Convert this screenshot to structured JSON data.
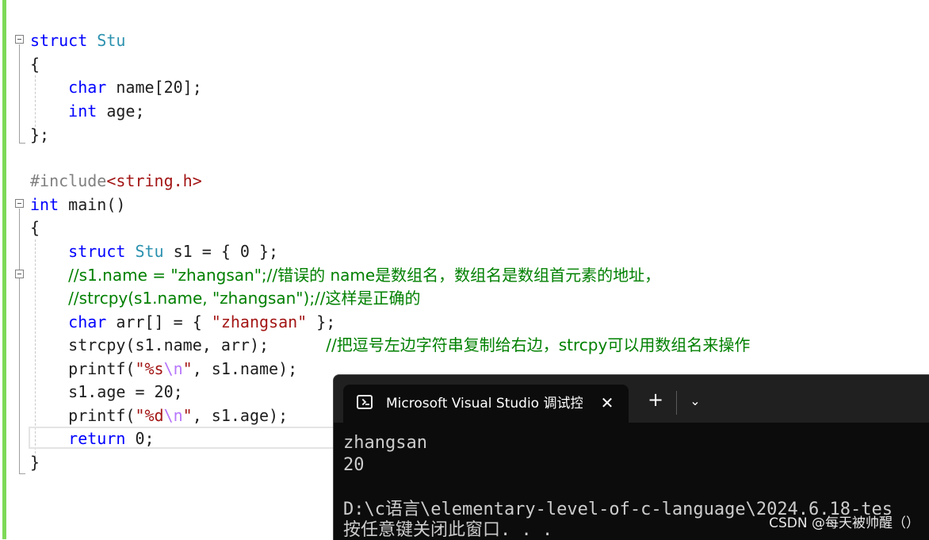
{
  "editor": {
    "lines": [
      {
        "parts": [
          {
            "t": "struct",
            "c": "kw"
          },
          {
            "t": " "
          },
          {
            "t": "Stu",
            "c": "ty"
          }
        ]
      },
      {
        "parts": [
          {
            "t": "{"
          }
        ]
      },
      {
        "parts": [
          {
            "t": "    "
          },
          {
            "t": "char",
            "c": "kw"
          },
          {
            "t": " name[20];"
          }
        ]
      },
      {
        "parts": [
          {
            "t": "    "
          },
          {
            "t": "int",
            "c": "kw"
          },
          {
            "t": " age;"
          }
        ]
      },
      {
        "parts": [
          {
            "t": "};"
          }
        ]
      },
      {
        "parts": []
      },
      {
        "parts": [
          {
            "t": "#include",
            "c": "pp"
          },
          {
            "t": "<string.h>",
            "c": "str"
          }
        ]
      },
      {
        "parts": [
          {
            "t": "int",
            "c": "kw"
          },
          {
            "t": " main()"
          }
        ]
      },
      {
        "parts": [
          {
            "t": "{"
          }
        ]
      },
      {
        "parts": [
          {
            "t": "    "
          },
          {
            "t": "struct",
            "c": "kw"
          },
          {
            "t": " "
          },
          {
            "t": "Stu",
            "c": "ty"
          },
          {
            "t": " s1 = { 0 };"
          }
        ]
      },
      {
        "parts": [
          {
            "t": "    "
          },
          {
            "t": "//s1.name = \"zhangsan\";//错误的 name是数组名，数组名是数组首元素的地址，",
            "c": "cm"
          }
        ]
      },
      {
        "parts": [
          {
            "t": "    "
          },
          {
            "t": "//strcpy(s1.name, \"zhangsan\");//这样是正确的",
            "c": "cm"
          }
        ]
      },
      {
        "parts": [
          {
            "t": "    "
          },
          {
            "t": "char",
            "c": "kw"
          },
          {
            "t": " arr[] = { "
          },
          {
            "t": "\"zhangsan\"",
            "c": "str"
          },
          {
            "t": " };"
          }
        ]
      },
      {
        "parts": [
          {
            "t": "    strcpy(s1.name, arr);      "
          },
          {
            "t": "//把逗号左边字符串复制给右边，strcpy可以用数组名来操作",
            "c": "cm"
          }
        ]
      },
      {
        "parts": [
          {
            "t": "    printf("
          },
          {
            "t": "\"%s",
            "c": "str"
          },
          {
            "t": "\\n",
            "c": "esc"
          },
          {
            "t": "\"",
            "c": "str"
          },
          {
            "t": ", s1.name);"
          }
        ]
      },
      {
        "parts": [
          {
            "t": "    s1.age = 20;"
          }
        ]
      },
      {
        "parts": [
          {
            "t": "    printf("
          },
          {
            "t": "\"%d",
            "c": "str"
          },
          {
            "t": "\\n",
            "c": "esc"
          },
          {
            "t": "\"",
            "c": "str"
          },
          {
            "t": ", s1.age);"
          }
        ]
      },
      {
        "parts": [
          {
            "t": "    "
          },
          {
            "t": "return",
            "c": "kw"
          },
          {
            "t": " 0;"
          }
        ]
      },
      {
        "parts": [
          {
            "t": "}"
          }
        ]
      }
    ],
    "colors": {
      "keyword": "#0000ff",
      "type": "#2b91af",
      "string": "#a31515",
      "comment": "#008000",
      "preprocessor": "#808080",
      "escape": "#b776fb",
      "gutter_bar": "#7ed957"
    }
  },
  "terminal": {
    "tab_title": "Microsoft Visual Studio 调试控制台",
    "close_glyph": "✕",
    "new_tab_glyph": "+",
    "dropdown_glyph": "⌄",
    "output": [
      "zhangsan",
      "20",
      "",
      "D:\\c语言\\elementary-level-of-c-language\\2024.6.18-tes",
      "按任意键关闭此窗口. . ."
    ],
    "icons": {
      "tab": "terminal-icon",
      "close": "close-icon",
      "new": "plus-icon",
      "dropdown": "chevron-down-icon"
    }
  },
  "watermark": "CSDN @每天被帅醒（）"
}
